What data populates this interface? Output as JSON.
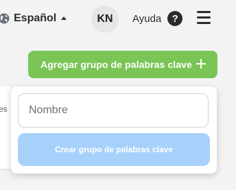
{
  "header": {
    "language": {
      "label": "Español",
      "icon": "globe-icon"
    },
    "avatar": {
      "initials": "KN"
    },
    "help": {
      "label": "Ayuda",
      "icon": "question-icon",
      "glyph": "?"
    },
    "menu": {
      "icon": "hamburger-menu-icon"
    }
  },
  "toolbar": {
    "add_group_label": "Agregar grupo de palabras clave",
    "add_icon": "plus-icon"
  },
  "background_panel": {
    "partial_text": "es"
  },
  "popover": {
    "name_input": {
      "placeholder": "Nombre",
      "value": ""
    },
    "create_button_label": "Crear grupo de palabras clave",
    "create_button_state": "disabled"
  },
  "colors": {
    "page_background": "#f3f3f4",
    "primary_green": "#7ac555",
    "disabled_blue": "#a7d1fa",
    "avatar_background": "#e6e6e8"
  }
}
